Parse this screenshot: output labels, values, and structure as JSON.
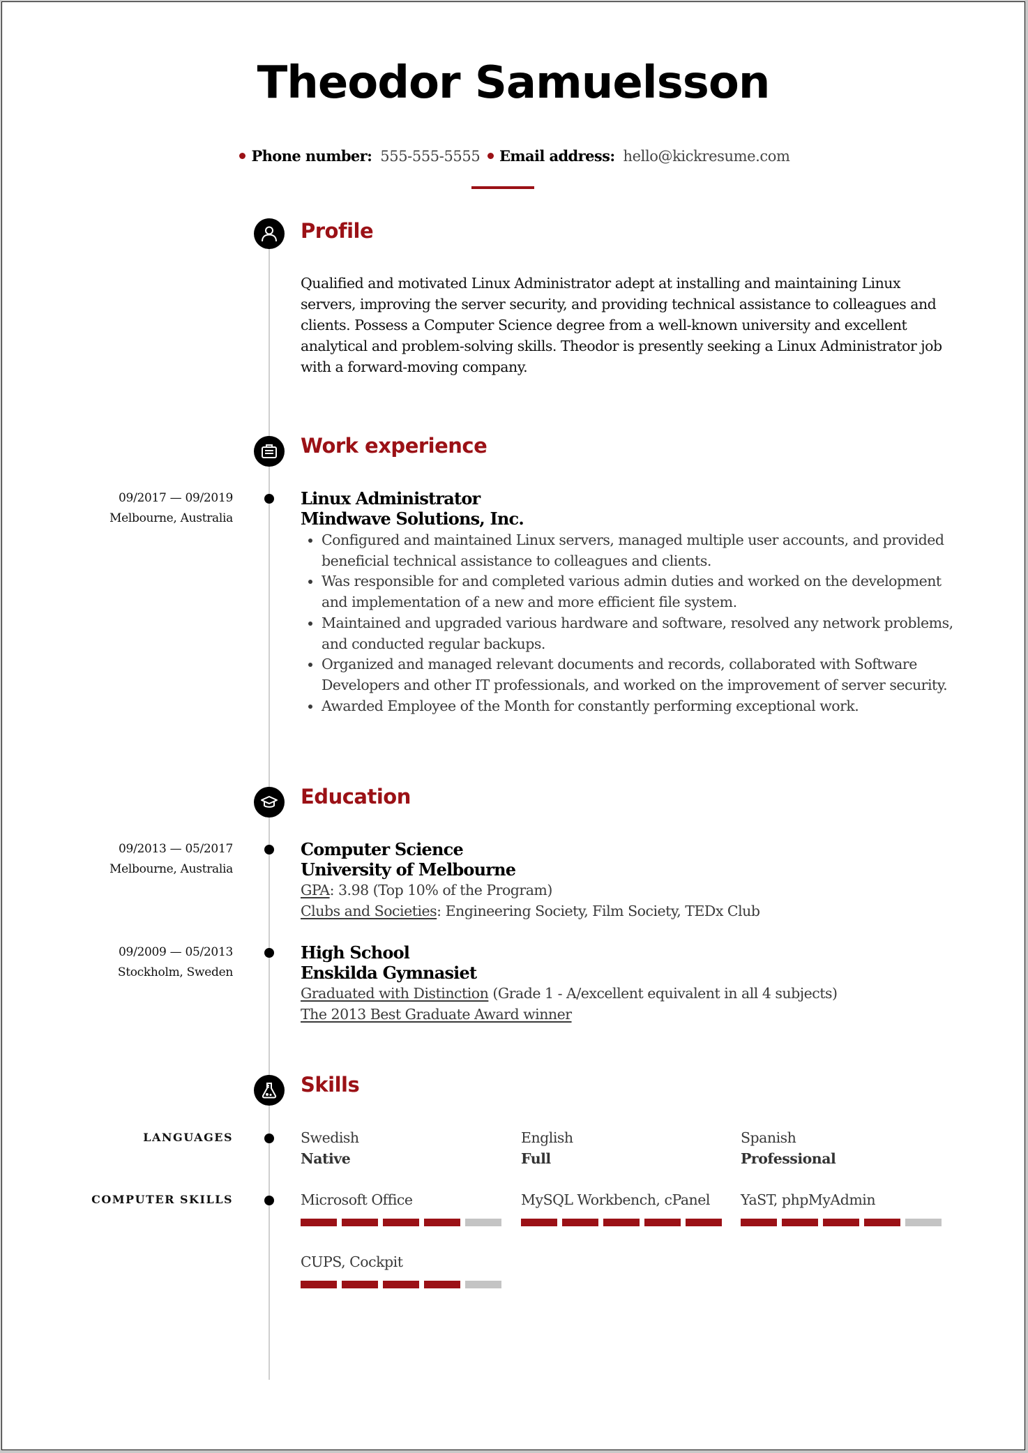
{
  "header": {
    "name": "Theodor Samuelsson",
    "phone_label": "Phone number:",
    "phone_value": "555-555-5555",
    "email_label": "Email address:",
    "email_value": "hello@kickresume.com"
  },
  "colors": {
    "accent": "#9b1116",
    "timeline": "#cfcfcf",
    "bar_empty": "#c4c4c4"
  },
  "profile": {
    "title": "Profile",
    "icon": "person-icon",
    "text": "Qualified and motivated Linux Administrator adept at installing and maintaining Linux servers, improving the server security, and providing technical assistance to colleagues and clients. Possess a Computer Science degree from a well-known university and excellent analytical and problem-solving skills. Theodor is presently seeking a Linux Administrator job with a forward-moving company."
  },
  "work": {
    "title": "Work experience",
    "icon": "briefcase-icon",
    "items": [
      {
        "dates": "09/2017 — 09/2019",
        "location": "Melbourne, Australia",
        "role": "Linux Administrator",
        "company": "Mindwave Solutions, Inc.",
        "bullets": [
          "Configured and maintained Linux servers, managed multiple user accounts, and provided beneficial technical assistance to colleagues and clients.",
          "Was responsible for and completed various admin duties and worked on the development and implementation of a new and more efficient file system.",
          "Maintained and upgraded various hardware and software, resolved any network problems, and conducted regular backups.",
          "Organized and managed relevant documents and records, collaborated with Software Developers and other IT professionals, and worked on the improvement of server security.",
          "Awarded Employee of the Month for constantly performing exceptional work."
        ]
      }
    ]
  },
  "education": {
    "title": "Education",
    "icon": "graduation-cap-icon",
    "items": [
      {
        "dates": "09/2013 — 05/2017",
        "location": "Melbourne, Australia",
        "degree": "Computer Science",
        "school": "University of Melbourne",
        "line1_u": "GPA",
        "line1_rest": ": 3.98 (Top 10% of the Program)",
        "line2_u": "Clubs and Societies",
        "line2_rest": ": Engineering Society, Film Society, TEDx Club"
      },
      {
        "dates": "09/2009 — 05/2013",
        "location": "Stockholm, Sweden",
        "degree": "High School",
        "school": "Enskilda Gymnasiet",
        "line1_u": "Graduated with Distinction",
        "line1_rest": " (Grade 1 - A/excellent equivalent in all 4 subjects)",
        "line2_u": "The 2013 Best Graduate Award winner",
        "line2_rest": ""
      }
    ]
  },
  "skills": {
    "title": "Skills",
    "icon": "flask-icon",
    "languages_label": "LANGUAGES",
    "languages": [
      {
        "name": "Swedish",
        "level": "Native"
      },
      {
        "name": "English",
        "level": "Full"
      },
      {
        "name": "Spanish",
        "level": "Professional"
      }
    ],
    "computer_label": "COMPUTER SKILLS",
    "computer": [
      {
        "name": "Microsoft Office",
        "rating": 4,
        "max": 5
      },
      {
        "name": "MySQL Workbench, cPanel",
        "rating": 5,
        "max": 5
      },
      {
        "name": "YaST, phpMyAdmin",
        "rating": 4,
        "max": 5
      },
      {
        "name": "CUPS, Cockpit",
        "rating": 4,
        "max": 5
      }
    ]
  }
}
